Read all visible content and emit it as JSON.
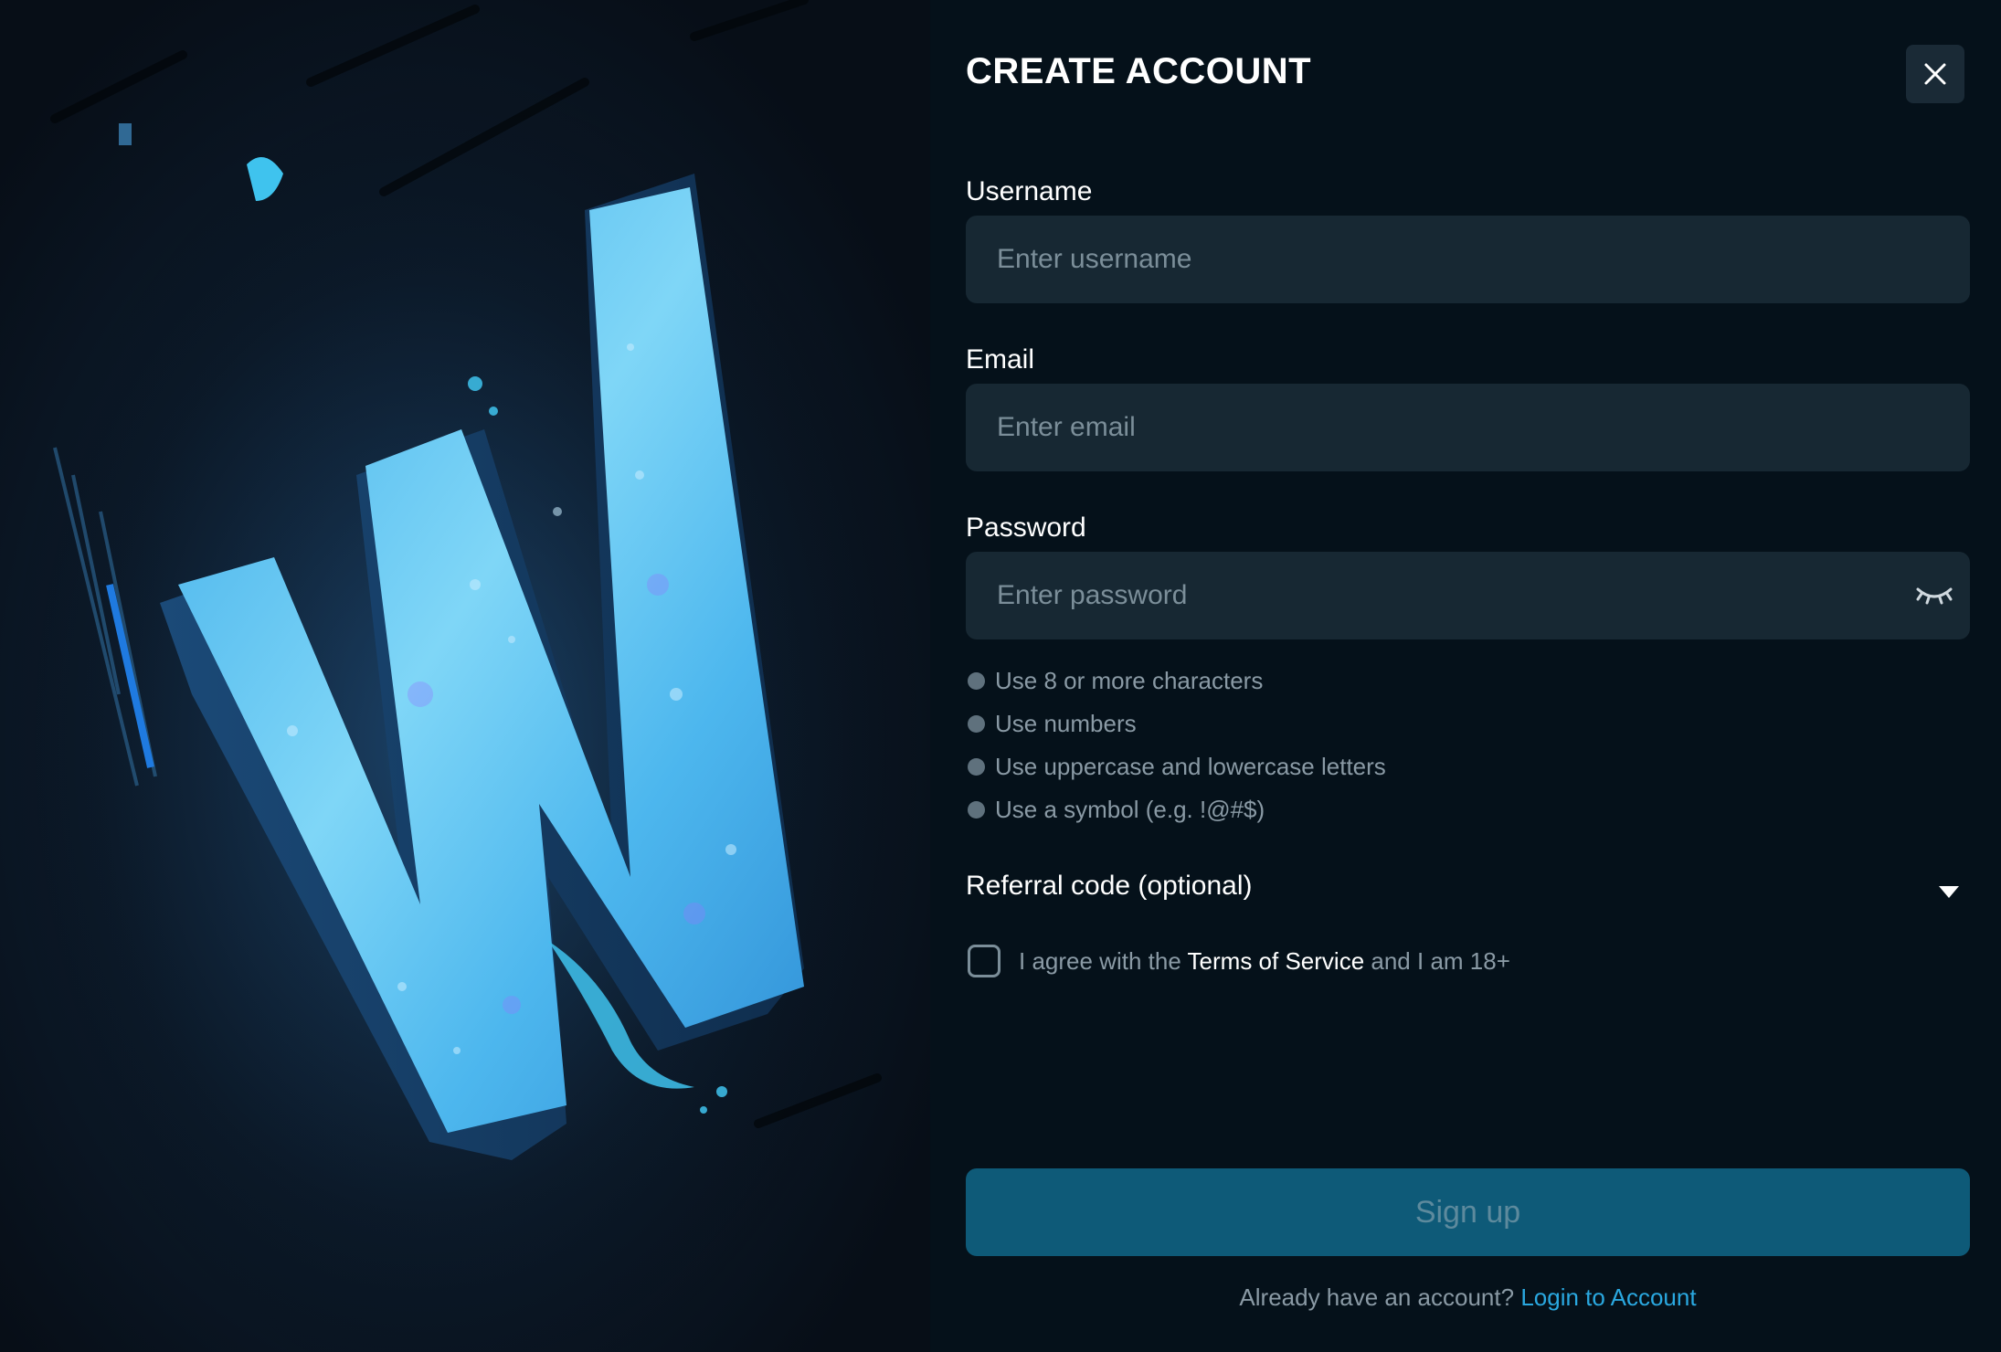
{
  "title": "CREATE ACCOUNT",
  "fields": {
    "username": {
      "label": "Username",
      "placeholder": "Enter username"
    },
    "email": {
      "label": "Email",
      "placeholder": "Enter email"
    },
    "password": {
      "label": "Password",
      "placeholder": "Enter password"
    }
  },
  "password_rules": [
    "Use 8 or more characters",
    "Use numbers",
    "Use uppercase and lowercase letters",
    "Use a symbol (e.g. !@#$)"
  ],
  "referral_label": "Referral code (optional)",
  "agree": {
    "prefix": "I agree with the",
    "tos": "Terms of Service",
    "suffix": "and I am 18+"
  },
  "signup_label": "Sign up",
  "footer": {
    "prompt": "Already have an account?",
    "login": "Login to Account"
  },
  "colors": {
    "accent": "#2aa8e0",
    "signup_bg": "#0e5a78",
    "input_bg": "#172833",
    "panel_bg": "#05111a"
  },
  "icons": {
    "close": "close-icon",
    "eye": "eye-closed-icon",
    "referral": "chevron-down-icon",
    "logo": "w-logo-art"
  }
}
